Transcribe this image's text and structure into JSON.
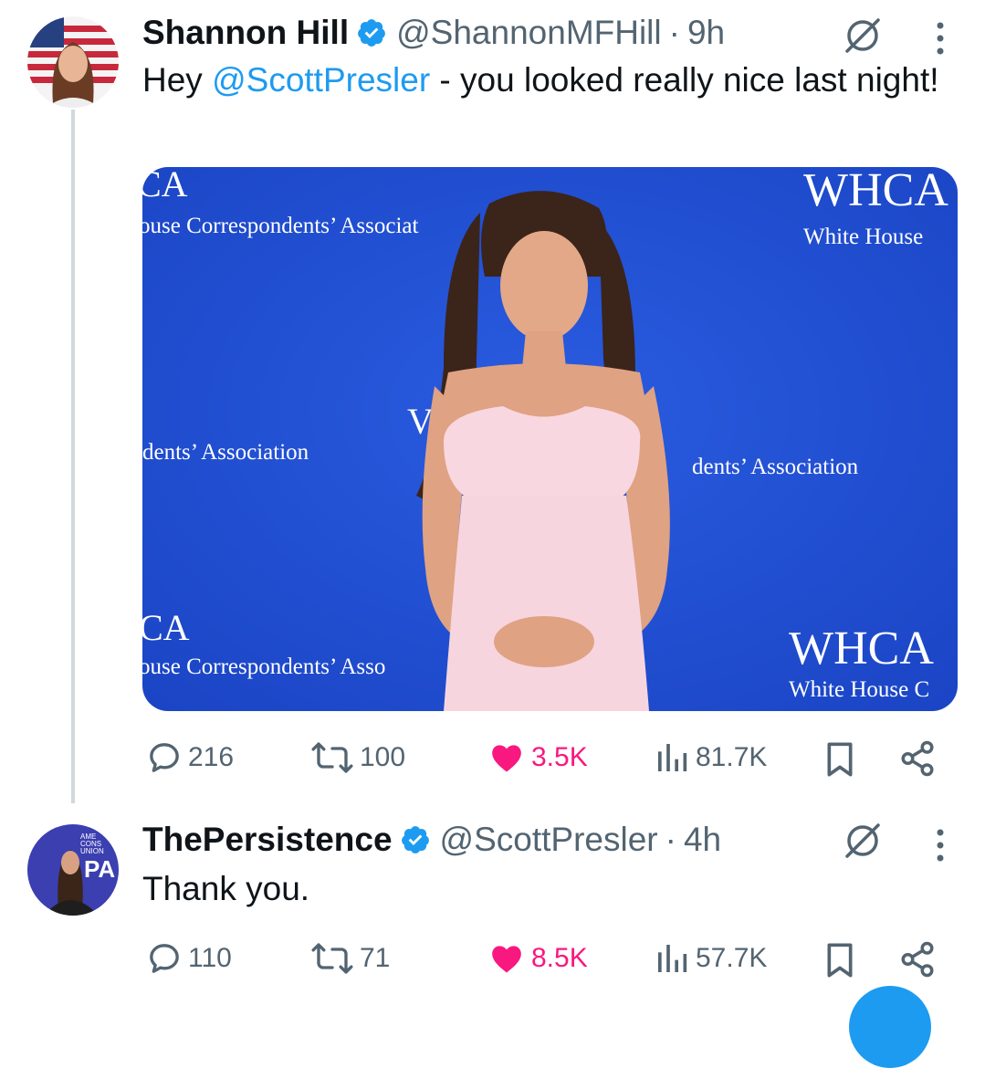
{
  "tweet1": {
    "author_name": "Shannon Hill",
    "handle": "@ShannonMFHill",
    "separator": "·",
    "time": "9h",
    "text_prefix": "Hey ",
    "mention": "@ScottPresler",
    "text_suffix": " - you looked really nice last night!",
    "media_backdrop_text": {
      "tl_logo": "CA",
      "tl_line": "ouse Correspondents’ Associat",
      "tr_logo": "WHCA",
      "tr_line": "White House",
      "ml_line": "dents’ Association",
      "mr_line": "dents’ Association",
      "mc_logo": "V",
      "bl_logo": "CA",
      "bl_line": "ouse Correspondents’ Asso",
      "br_logo": "WHCA",
      "br_line": "White House C"
    },
    "actions": {
      "replies": "216",
      "reposts": "100",
      "likes": "3.5K",
      "views": "81.7K"
    }
  },
  "tweet2": {
    "author_name": "ThePersistence",
    "handle": "@ScottPresler",
    "separator": "·",
    "time": "4h",
    "text": "Thank you.",
    "avatar_text": {
      "line1": "AME",
      "line2": "CONS",
      "line3": "UNION",
      "logo": "PA"
    },
    "actions": {
      "replies": "110",
      "reposts": "71",
      "likes": "8.5K",
      "views": "57.7K"
    }
  },
  "colors": {
    "link": "#1d9bf0",
    "like_active": "#f91880",
    "secondary_text": "#536471",
    "thread_line": "#cfd9de",
    "media_background": "#1f4fd6"
  },
  "icons": [
    "verified-badge-icon",
    "grok-icon",
    "more-icon",
    "reply-icon",
    "repost-icon",
    "heart-icon",
    "views-icon",
    "bookmark-icon",
    "share-icon"
  ]
}
